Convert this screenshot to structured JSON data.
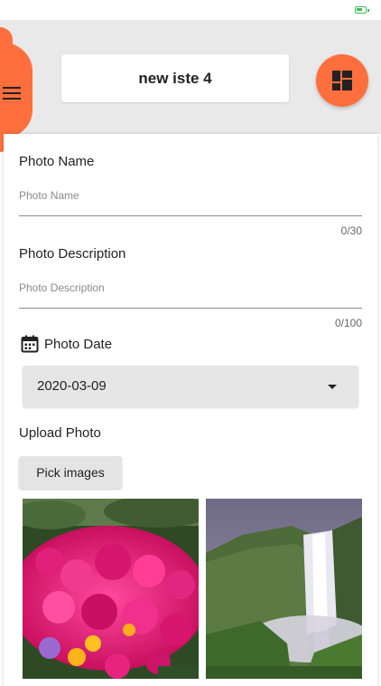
{
  "status": {
    "battery_color": "#3dbb4e"
  },
  "header": {
    "menu_icon": "hamburger-menu-icon",
    "title": "new iste 4",
    "layout_icon": "dashboard-grid-icon",
    "accent_color": "#ff6f3d"
  },
  "form": {
    "photo_name": {
      "label": "Photo Name",
      "placeholder": "Photo Name",
      "counter": "0/30"
    },
    "photo_description": {
      "label": "Photo Description",
      "placeholder": "Photo Description",
      "counter": "0/100"
    },
    "photo_date": {
      "label": "Photo Date",
      "icon": "calendar-icon",
      "value": "2020-03-09"
    },
    "upload": {
      "label": "Upload Photo",
      "button_label": "Pick images"
    }
  },
  "photos": [
    {
      "subject": "pink flowers"
    },
    {
      "subject": "waterfall"
    }
  ]
}
